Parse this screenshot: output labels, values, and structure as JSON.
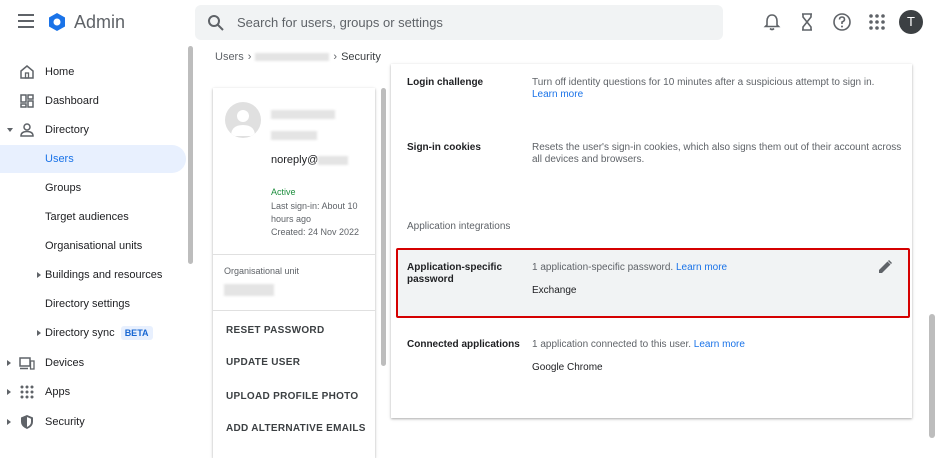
{
  "app": {
    "title": "Admin",
    "avatar_letter": "T"
  },
  "search": {
    "placeholder": "Search for users, groups or settings"
  },
  "topbar_icons": [
    "bell-icon",
    "hourglass-icon",
    "help-icon",
    "apps-grid-icon"
  ],
  "sidebar": {
    "items": [
      {
        "label": "Home",
        "icon": "home-icon"
      },
      {
        "label": "Dashboard",
        "icon": "dashboard-icon"
      },
      {
        "label": "Directory",
        "icon": "person-icon"
      },
      {
        "label": "Users"
      },
      {
        "label": "Groups"
      },
      {
        "label": "Target audiences"
      },
      {
        "label": "Organisational units"
      },
      {
        "label": "Buildings and resources"
      },
      {
        "label": "Directory settings"
      },
      {
        "label": "Directory sync",
        "badge": "BETA"
      },
      {
        "label": "Devices",
        "icon": "devices-icon"
      },
      {
        "label": "Apps",
        "icon": "apps-grid-icon"
      },
      {
        "label": "Security",
        "icon": "shield-icon"
      }
    ]
  },
  "breadcrumb": {
    "root": "Users",
    "current": "Security"
  },
  "profile": {
    "email_prefix": "noreply@",
    "status": "Active",
    "last_signin": "Last sign-in: About 10 hours ago",
    "created": "Created: 24 Nov 2022",
    "ou_label": "Organisational unit",
    "actions": [
      "RESET PASSWORD",
      "UPDATE USER",
      "UPLOAD PROFILE PHOTO",
      "ADD ALTERNATIVE EMAILS"
    ]
  },
  "settings": {
    "login_challenge": {
      "title": "Login challenge",
      "desc": "Turn off identity questions for 10 minutes after a suspicious attempt to sign in.",
      "link": "Learn more"
    },
    "signin_cookies": {
      "title": "Sign-in cookies",
      "desc": "Resets the user's sign-in cookies, which also signs them out of their account across all devices and browsers."
    },
    "section_label": "Application integrations",
    "app_passwords": {
      "title": "Application-specific password",
      "desc": "1 application-specific password.",
      "link": "Learn more",
      "value": "Exchange"
    },
    "connected_apps": {
      "title": "Connected applications",
      "desc": "1 application connected to this user.",
      "link": "Learn more",
      "value": "Google Chrome"
    }
  },
  "colors": {
    "accent": "#1a73e8",
    "highlight_border": "#d50000",
    "active_status": "#1e8e3e"
  }
}
